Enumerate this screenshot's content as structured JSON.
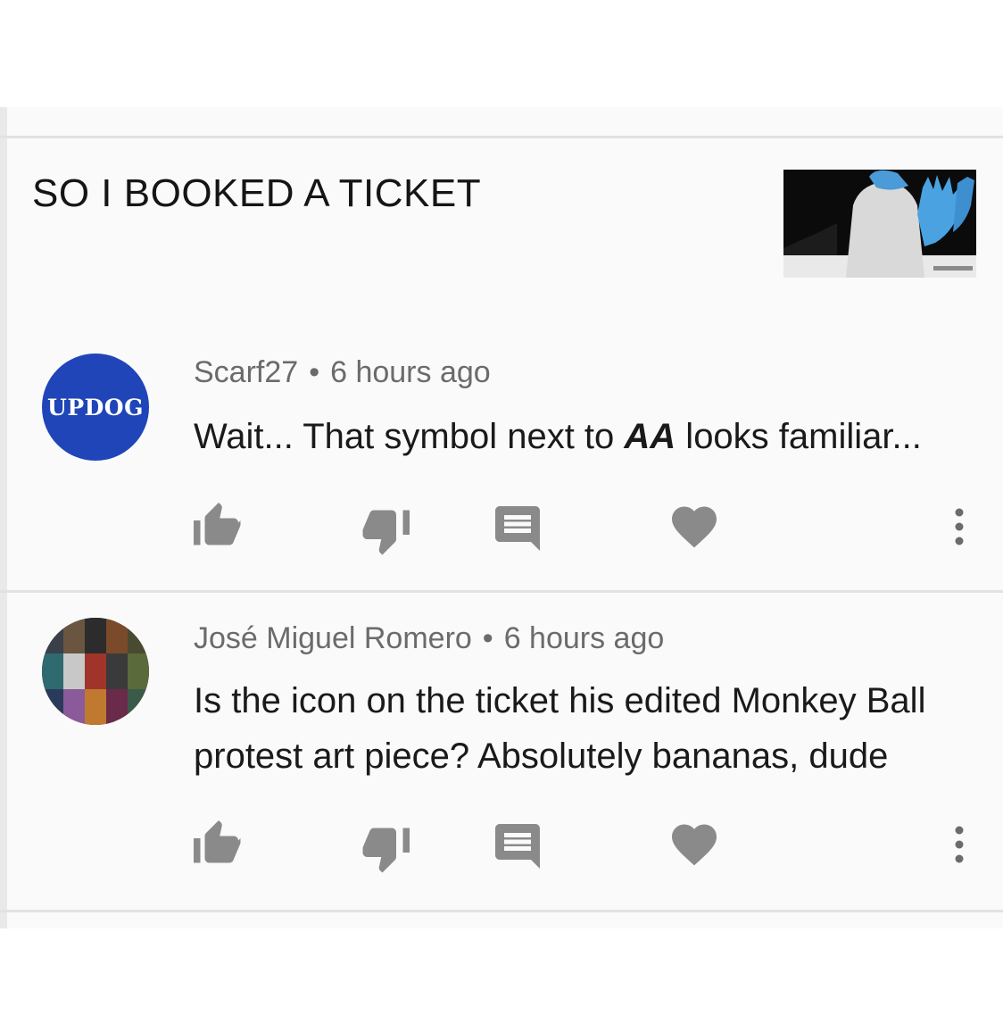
{
  "video": {
    "title": "SO I BOOKED A TICKET"
  },
  "comments": [
    {
      "author": "Scarf27",
      "separator": "•",
      "time": "6 hours ago",
      "avatar_text": "UPDOG",
      "text_before": "Wait... That symbol next to ",
      "text_emphasis": "AA",
      "text_after": " looks familiar..."
    },
    {
      "author": "José Miguel Romero",
      "separator": "•",
      "time": "6 hours ago",
      "text_line1": "Is the icon on the ticket his edited Monkey Ball",
      "text_line2": "protest art piece? Absolutely bananas, dude"
    }
  ],
  "icons": {
    "like": "thumbs-up-icon",
    "dislike": "thumbs-down-icon",
    "reply": "comment-icon",
    "heart": "heart-icon",
    "more": "more-vertical-icon"
  },
  "colors": {
    "icon_gray": "#8a8a8a",
    "meta_gray": "#6b6b6b",
    "updog_blue": "#1f45b8"
  }
}
